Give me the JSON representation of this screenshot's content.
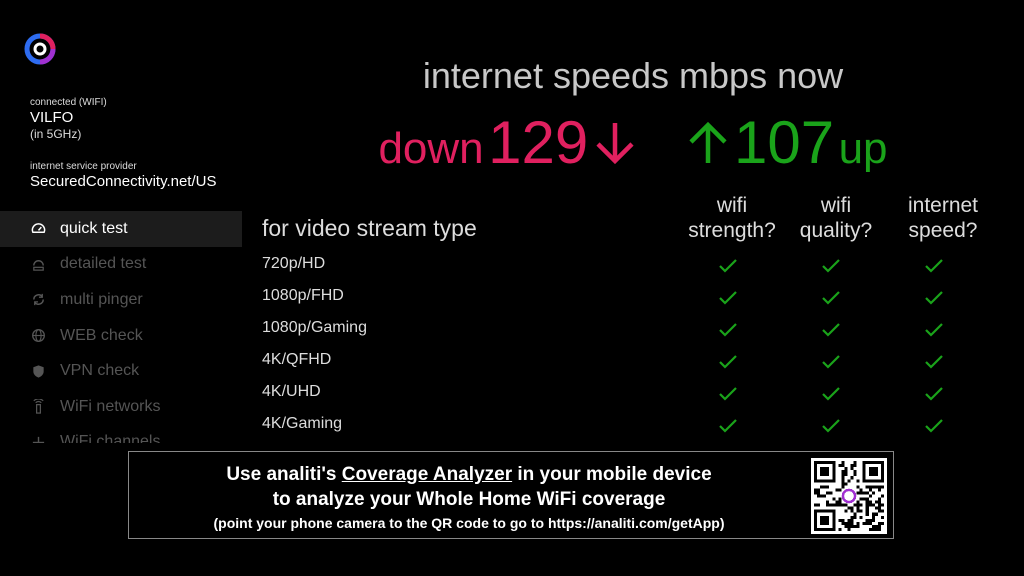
{
  "sidebar": {
    "connection_label": "connected (WIFI)",
    "network_name": "VILFO",
    "band": "(in 5GHz)",
    "isp_label": "internet service provider",
    "isp_name": "SecuredConnectivity.net/US",
    "items": [
      {
        "label": "quick test",
        "icon": "speedometer-icon"
      },
      {
        "label": "detailed test",
        "icon": "detailed-test-icon"
      },
      {
        "label": "multi pinger",
        "icon": "refresh-icon"
      },
      {
        "label": "WEB check",
        "icon": "globe-icon"
      },
      {
        "label": "VPN check",
        "icon": "shield-icon"
      },
      {
        "label": "WiFi networks",
        "icon": "wifi-router-icon"
      },
      {
        "label": "WiFi channels",
        "icon": "channels-icon"
      }
    ]
  },
  "main": {
    "title": "internet speeds mbps now",
    "down_label": "down",
    "down_value": "129",
    "up_value": "107",
    "up_label": "up",
    "stream_type_label": "for video stream type",
    "columns": [
      "wifi strength?",
      "wifi quality?",
      "internet speed?"
    ],
    "rows": [
      {
        "label": "720p/HD",
        "checks": [
          true,
          true,
          true
        ]
      },
      {
        "label": "1080p/FHD",
        "checks": [
          true,
          true,
          true
        ]
      },
      {
        "label": "1080p/Gaming",
        "checks": [
          true,
          true,
          true
        ]
      },
      {
        "label": "4K/QFHD",
        "checks": [
          true,
          true,
          true
        ]
      },
      {
        "label": "4K/UHD",
        "checks": [
          true,
          true,
          true
        ]
      },
      {
        "label": "4K/Gaming",
        "checks": [
          true,
          true,
          true
        ]
      }
    ]
  },
  "banner": {
    "line1_prefix": "Use analiti's ",
    "line1_link": "Coverage Analyzer",
    "line1_suffix": " in your mobile device",
    "line2": "to analyze your Whole Home WiFi coverage",
    "line3": "(point your phone camera to the QR code to go to https://analiti.com/getApp)"
  },
  "colors": {
    "down": "#e0205f",
    "up": "#1aa31a",
    "check": "#1aa31a",
    "background": "#000000"
  }
}
